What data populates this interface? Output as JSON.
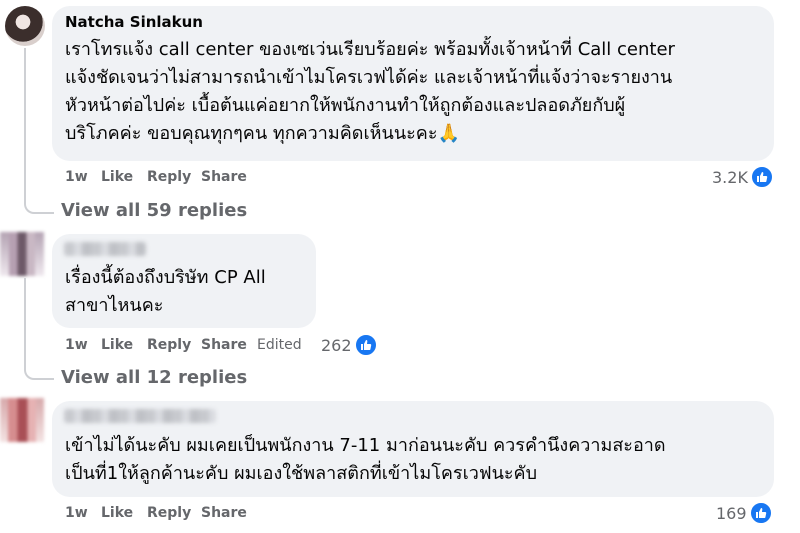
{
  "comments": [
    {
      "author": "Natcha Sinlakun",
      "lines": [
        "เราโทรแจ้ง call center ของเซเว่นเรียบร้อยค่ะ พร้อมทั้งเจ้าหน้าที่ Call center",
        "แจ้งชัดเจนว่าไม่สามารถนำเข้าไมโครเวฟได้ค่ะ และเจ้าหน้าที่แจ้งว่าจะรายงาน",
        "หัวหน้าต่อไปค่ะ เบื้อต้นแค่อยากให้พนักงานทำให้ถูกต้องและปลอดภัยกับผู้",
        "บริโภคค่ะ ขอบคุณทุกๆคน ทุกความคิดเห็นนะคะ🙏"
      ],
      "time": "1w",
      "like": "Like",
      "reply": "Reply",
      "share": "Share",
      "reactions": "3.2K",
      "view_replies": "View all 59 replies"
    },
    {
      "lines": [
        "เรื่องนี้ต้องถึงบริษัท CP All",
        "สาขาไหนคะ"
      ],
      "time": "1w",
      "like": "Like",
      "reply": "Reply",
      "share": "Share",
      "edited": "Edited",
      "reactions": "262",
      "view_replies": "View all 12 replies"
    },
    {
      "lines": [
        "เข้าไม่ได้นะคับ ผมเคยเป็นพนักงาน 7-11 มาก่อนนะคับ ควรคำนึงความสะอาด",
        "เป็นที่1ให้ลูกค้านะคับ ผมเองใช้พลาสติกที่เข้าไมโครเวฟนะคับ"
      ],
      "time": "1w",
      "like": "Like",
      "reply": "Reply",
      "share": "Share",
      "reactions": "169"
    }
  ],
  "colors": {
    "bubble": "#f0f2f5",
    "meta": "#65676b",
    "like_blue": "#1877f2"
  }
}
